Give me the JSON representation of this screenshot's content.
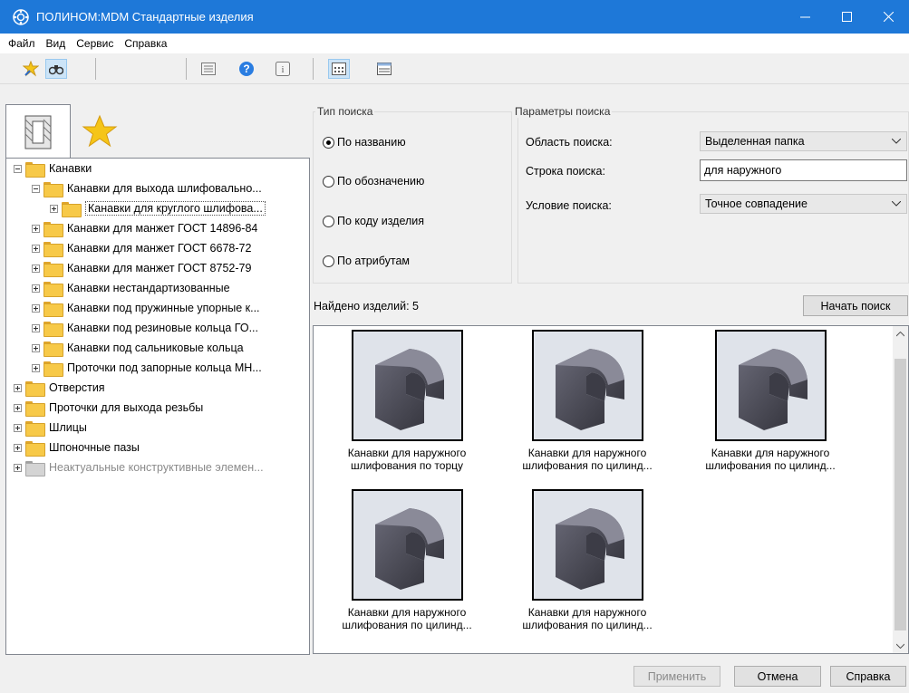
{
  "window": {
    "title": "ПОЛИНОМ:MDM Стандартные изделия",
    "titlebar_color": "#1e78d8"
  },
  "menu": [
    "Файл",
    "Вид",
    "Сервис",
    "Справка"
  ],
  "toolbar": {
    "icons": [
      "pin-icon",
      "binoculars-icon",
      "list-view-icon",
      "help-icon",
      "info-icon",
      "grid-view-icon",
      "table-view-icon"
    ]
  },
  "tree": {
    "items": [
      {
        "label": "Канавки",
        "level": 0,
        "expanded": true
      },
      {
        "label": "Канавки для выхода шлифовально...",
        "level": 1,
        "expanded": true
      },
      {
        "label": "Канавки для круглого шлифова...",
        "level": 2,
        "selected": true
      },
      {
        "label": "Канавки для манжет ГОСТ 14896-84",
        "level": 1
      },
      {
        "label": "Канавки для манжет ГОСТ 6678-72",
        "level": 1
      },
      {
        "label": "Канавки для манжет ГОСТ 8752-79",
        "level": 1
      },
      {
        "label": "Канавки нестандартизованные",
        "level": 1
      },
      {
        "label": "Канавки под пружинные упорные к...",
        "level": 1
      },
      {
        "label": "Канавки под резиновые кольца ГО...",
        "level": 1
      },
      {
        "label": "Канавки под сальниковые кольца",
        "level": 1
      },
      {
        "label": "Проточки под запорные кольца МН...",
        "level": 1
      },
      {
        "label": "Отверстия",
        "level": 0
      },
      {
        "label": "Проточки для выхода резьбы",
        "level": 0
      },
      {
        "label": "Шлицы",
        "level": 0
      },
      {
        "label": "Шпоночные пазы",
        "level": 0
      },
      {
        "label": "Неактуальные конструктивные элемен...",
        "level": 0,
        "grey": true
      }
    ]
  },
  "search_type": {
    "title": "Тип поиска",
    "options": [
      "По названию",
      "По обозначению",
      "По коду изделия",
      "По атрибутам"
    ],
    "selected": "По названию"
  },
  "search_params": {
    "title": "Параметры поиска",
    "area_label": "Область поиска:",
    "area_value": "Выделенная папка",
    "string_label": "Строка поиска:",
    "string_value": "для наружного",
    "condition_label": "Условие поиска:",
    "condition_value": "Точное совпадение"
  },
  "found_label": "Найдено изделий: 5",
  "start_search": "Начать поиск",
  "results": [
    {
      "line1": "Канавки для наружного",
      "line2": "шлифования по торцу"
    },
    {
      "line1": "Канавки для наружного",
      "line2": "шлифования по цилинд..."
    },
    {
      "line1": "Канавки для наружного",
      "line2": "шлифования по цилинд..."
    },
    {
      "line1": "Канавки для наружного",
      "line2": "шлифования по цилинд..."
    },
    {
      "line1": "Канавки для наружного",
      "line2": "шлифования по цилинд..."
    }
  ],
  "buttons": {
    "apply": "Применить",
    "cancel": "Отмена",
    "help": "Справка"
  }
}
